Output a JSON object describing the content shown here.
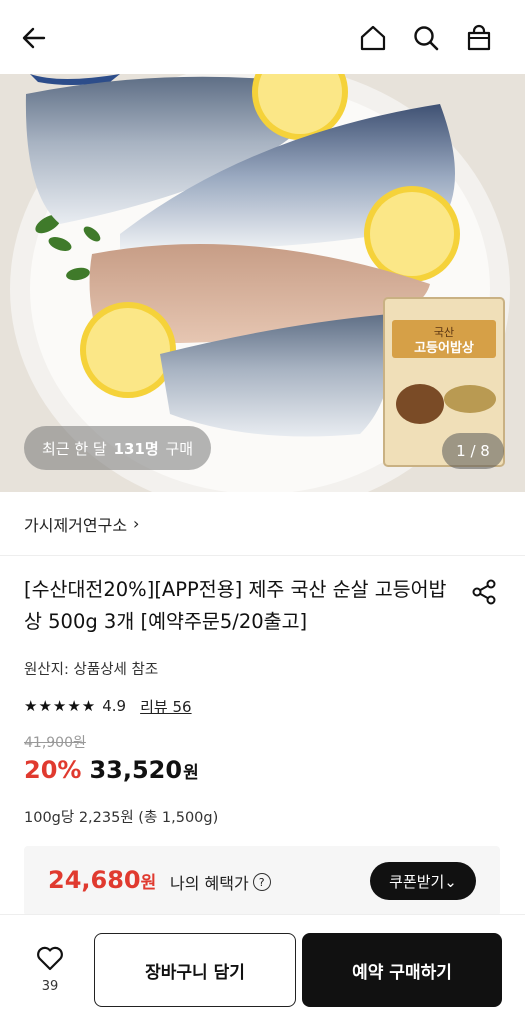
{
  "header": {
    "back_icon": "arrow-left-icon",
    "home_icon": "home-icon",
    "search_icon": "search-icon",
    "bag_icon": "shopping-bag-icon"
  },
  "hero": {
    "buyers_prefix": "최근 한 달",
    "buyers_count": "131명",
    "buyers_suffix": "구매",
    "image_counter": "1 / 8",
    "package_text_1": "국산",
    "package_text_2": "고등어밥상"
  },
  "brand": {
    "name": "가시제거연구소",
    "chevron": "›"
  },
  "product": {
    "title": "[수산대전20%][APP전용] 제주 국산 순살 고등어밥상 500g 3개 [예약주문5/20출고]",
    "origin": "원산지: 상품상세 참조",
    "stars": "★★★★★",
    "rating": "4.9",
    "review_label": "리뷰 56",
    "original_price": "41,900원",
    "discount_rate": "20%",
    "price": "33,520",
    "price_unit": "원",
    "per_unit": "100g당 2,235원 (총 1,500g)"
  },
  "benefit": {
    "price": "24,680",
    "price_unit": "원",
    "label": "나의 혜택가",
    "help_icon": "?",
    "coupon_button": "쿠폰받기⌄"
  },
  "bottom": {
    "wish_count": "39",
    "cart_button": "장바구니 담기",
    "buy_button": "예약 구매하기"
  },
  "colors": {
    "accent_red": "#e03a2f",
    "dark": "#111111"
  }
}
